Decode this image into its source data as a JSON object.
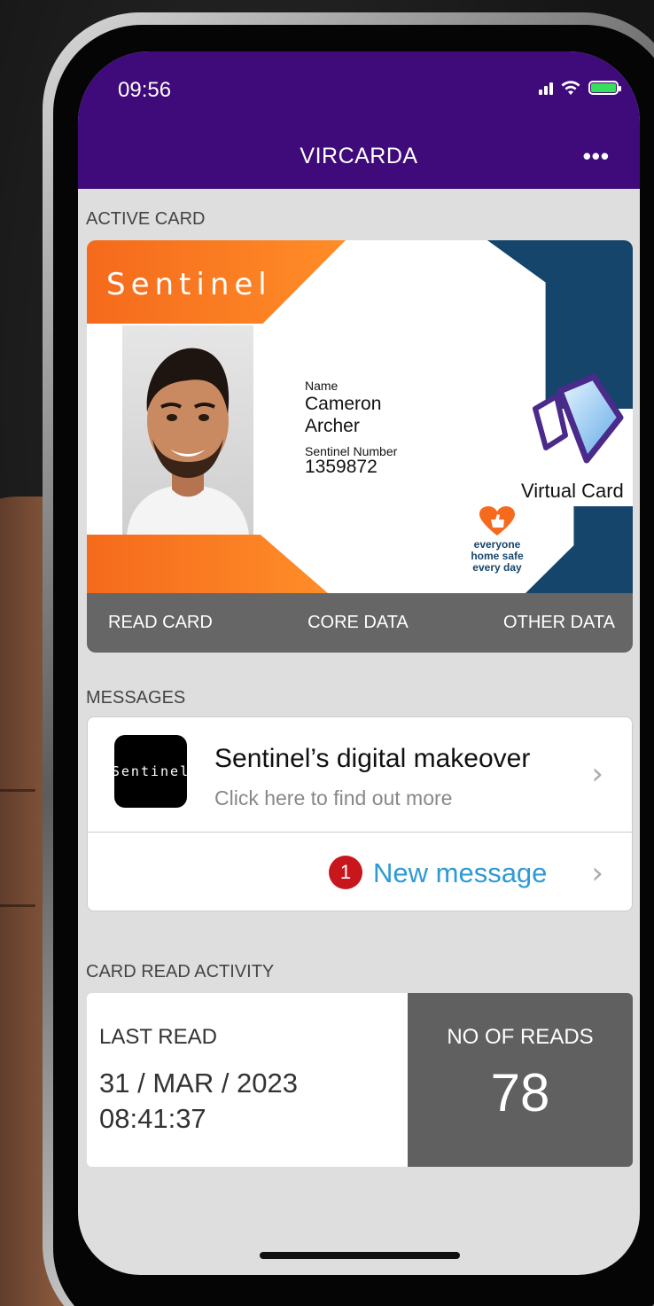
{
  "status_bar": {
    "time": "09:56"
  },
  "header": {
    "title": "VIRCARDA",
    "more_label": "•••"
  },
  "active_card": {
    "section_label": "ACTIVE CARD",
    "brand": "Sentinel",
    "name_label": "Name",
    "first_name": "Cameron",
    "last_name": "Archer",
    "number_label": "Sentinel Number",
    "number": "1359872",
    "virtual_label": "Virtual Card",
    "slogan_line1": "everyone",
    "slogan_line2": "home safe",
    "slogan_line3": "every day",
    "actions": [
      "READ CARD",
      "CORE DATA",
      "OTHER DATA"
    ],
    "colors": {
      "orange": "#f56a1c",
      "navy": "#15456b",
      "purple": "#3f0b7a"
    }
  },
  "messages": {
    "section_label": "MESSAGES",
    "app_icon_text": "Sentinel",
    "title": "Sentinel’s digital makeover",
    "subtitle": "Click here to find out more",
    "new_count": "1",
    "new_label": "New message"
  },
  "activity": {
    "section_label": "CARD READ ACTIVITY",
    "last_read_label": "LAST READ",
    "last_read_date": "31 / MAR / 2023",
    "last_read_time": "08:41:37",
    "reads_label": "NO OF READS",
    "reads_value": "78"
  },
  "icons": {
    "signal": "signal-icon",
    "wifi": "wifi-icon",
    "battery": "battery-icon",
    "chevron": "chevron-right-icon"
  }
}
